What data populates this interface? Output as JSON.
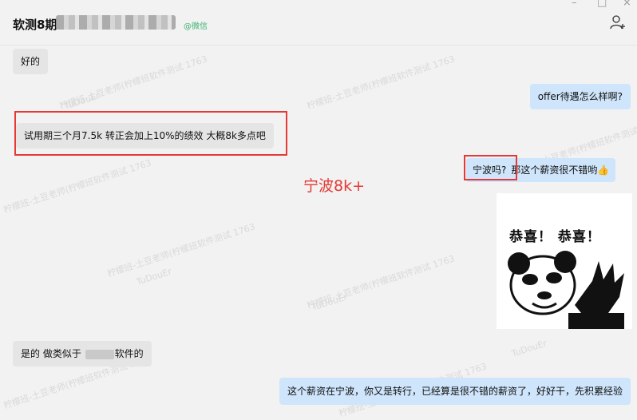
{
  "header": {
    "title": "软测8期",
    "wechat_tag": "@微信",
    "window_controls": [
      "–",
      "□",
      "×"
    ]
  },
  "watermarks": [
    "柠檬班-土豆老师(柠檬班软件测试 1763",
    "TuDouEr"
  ],
  "messages": [
    {
      "side": "in",
      "text": "好的"
    },
    {
      "side": "out",
      "text": "offer待遇怎么样啊?"
    },
    {
      "side": "in",
      "text": "试用期三个月7.5k   转正会加上10%的绩效  大概8k多点吧"
    },
    {
      "side": "out",
      "part1": "宁波吗?",
      "part2": "那这个薪资很不错哟",
      "emoji": "👍"
    },
    {
      "side": "in",
      "sticker": true,
      "sticker_text": "恭喜！ 恭喜！"
    },
    {
      "side": "in",
      "part1": "是的  做类似于",
      "part2": "软件的"
    },
    {
      "side": "out",
      "text": "这个薪资在宁波，你又是转行，已经算是很不错的薪资了，好好干，先积累经验"
    }
  ],
  "annotation": "宁波8k+",
  "colors": {
    "highlight": "#e53935",
    "incoming": "#e5e5e5",
    "outgoing": "#cfe5fb",
    "wechat_green": "#3cb371"
  }
}
